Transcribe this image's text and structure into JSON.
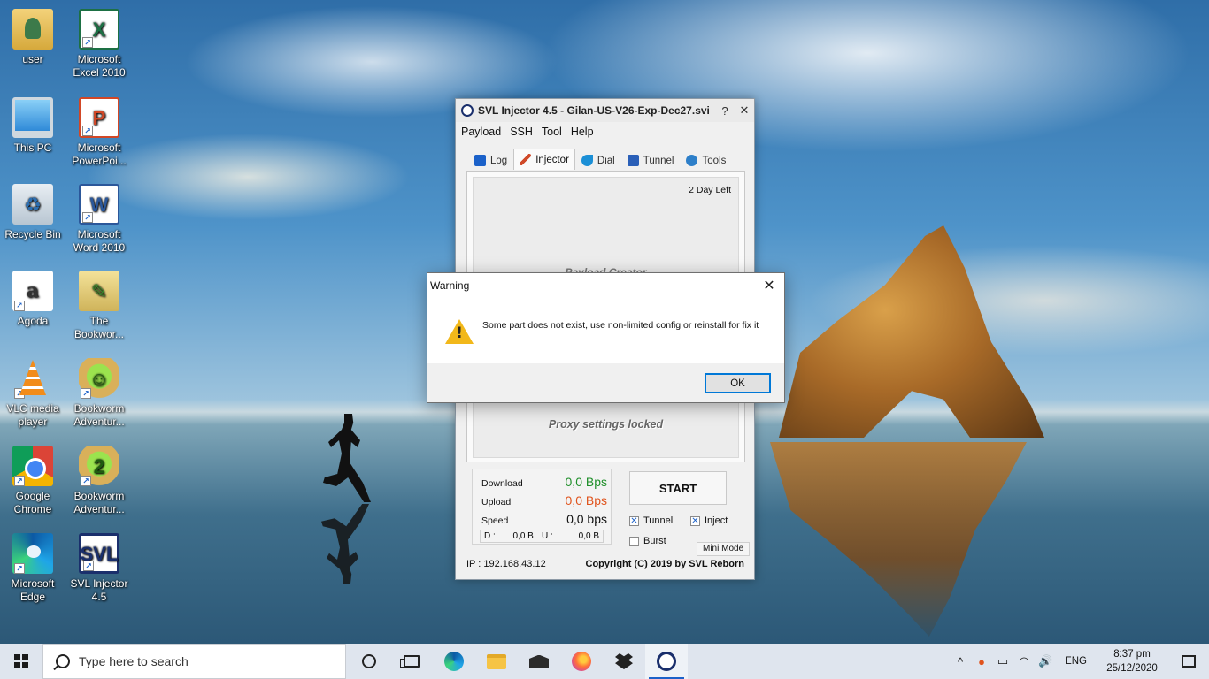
{
  "desktop": {
    "icons": [
      {
        "label": "user"
      },
      {
        "label": "Microsoft Excel 2010",
        "glyph": "X"
      },
      {
        "label": "This PC"
      },
      {
        "label": "Microsoft PowerPoi...",
        "glyph": "P"
      },
      {
        "label": "Recycle Bin",
        "glyph": "♻"
      },
      {
        "label": "Microsoft Word 2010",
        "glyph": "W"
      },
      {
        "label": "Agoda",
        "glyph": "a"
      },
      {
        "label": "The Bookwor...",
        "glyph": "✎"
      },
      {
        "label": "VLC media player"
      },
      {
        "label": "Bookworm Adventur...",
        "glyph": "☺"
      },
      {
        "label": "Google Chrome"
      },
      {
        "label": "Bookworm Adventur...",
        "glyph": "2"
      },
      {
        "label": "Microsoft Edge"
      },
      {
        "label": "SVL Injector 4.5",
        "glyph": "SVL"
      }
    ]
  },
  "svl_window": {
    "title": "SVL Injector 4.5 - Gilan-US-V26-Exp-Dec27.svi",
    "title_buttons": {
      "help": "?",
      "close": "✕"
    },
    "menu": [
      "Payload",
      "SSH",
      "Tool",
      "Help"
    ],
    "tabs": [
      {
        "label": "Log",
        "icon": "log-icon",
        "color": "#1b61c9"
      },
      {
        "label": "Injector",
        "icon": "syringe-icon",
        "color": "#d04a2a"
      },
      {
        "label": "Dial",
        "icon": "phone-icon",
        "color": "#1b8fd6"
      },
      {
        "label": "Tunnel",
        "icon": "tunnel-icon",
        "color": "#2a5fb8"
      },
      {
        "label": "Tools",
        "icon": "tools-icon",
        "color": "#2d7fc9"
      }
    ],
    "active_tab": "Injector",
    "days_left": "2 Day Left",
    "payload_creator": "Payload Creator",
    "proxy_locked": "Proxy settings locked",
    "stats": {
      "download_label": "Download",
      "download_value": "0,0 Bps",
      "upload_label": "Upload",
      "upload_value": "0,0 Bps",
      "speed_label": "Speed",
      "speed_value": "0,0 bps",
      "d_label": "D :",
      "d_value": "0,0 B",
      "u_label": "U :",
      "u_value": "0,0 B"
    },
    "start_label": "START",
    "checkboxes": {
      "tunnel": "Tunnel",
      "inject": "Inject",
      "burst": "Burst"
    },
    "mini_mode": "Mini Mode",
    "ip": "IP : 192.168.43.12",
    "copyright": "Copyright (C) 2019 by SVL Reborn"
  },
  "dialog": {
    "title": "Warning",
    "close": "✕",
    "message": "Some part does not exist, use non-limited config or reinstall for fix it",
    "ok_label": "OK"
  },
  "taskbar": {
    "search_placeholder": "Type here to search",
    "tray": {
      "chevron": "^",
      "network": "◠",
      "battery": "▭",
      "volume": "🔊",
      "language": "ENG"
    },
    "time": "8:37 pm",
    "date": "25/12/2020"
  }
}
